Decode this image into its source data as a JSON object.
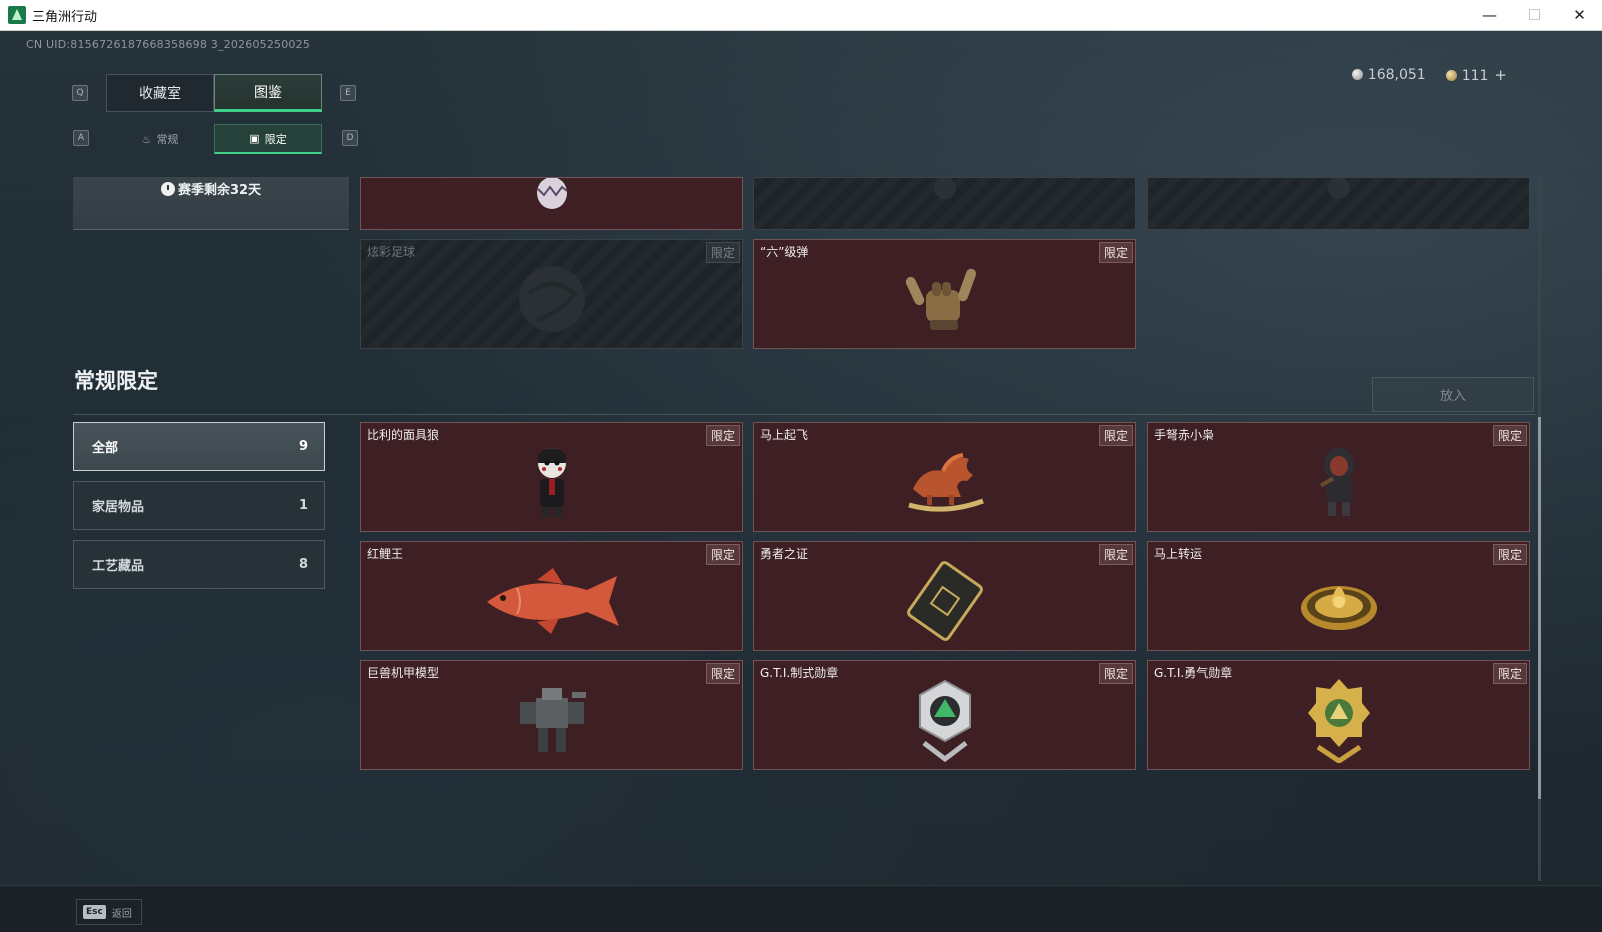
{
  "window": {
    "title": "三角洲行动",
    "min_glyph": "—",
    "max_glyph": "☐",
    "close_glyph": "✕"
  },
  "uid_text": "CN UID:8156726187668358698 3_202605250025",
  "currency": {
    "silver": "168,051",
    "gold": "111",
    "plus": "+"
  },
  "keys": {
    "prev_tab": "Q",
    "next_tab": "E",
    "prev_sub": "A",
    "next_sub": "D"
  },
  "tabs_main": [
    {
      "label": "收藏室",
      "active": false
    },
    {
      "label": "图鉴",
      "active": true
    }
  ],
  "tabs_sub": [
    {
      "label": "常规",
      "icon": "flame-icon",
      "active": false
    },
    {
      "label": "限定",
      "icon": "image-icon",
      "active": true
    }
  ],
  "season": {
    "text": "赛季剩余32天"
  },
  "top_cards": [
    {
      "name": "",
      "tag": "",
      "locked": false,
      "icon": "egg-icon"
    },
    {
      "name": "",
      "tag": "",
      "locked": true,
      "icon": "locked-item-icon"
    },
    {
      "name": "",
      "tag": "",
      "locked": true,
      "icon": "locked-item-icon"
    },
    {
      "name": "炫彩足球",
      "tag": "限定",
      "locked": true,
      "icon": "football-icon"
    },
    {
      "name": "“六”级弹",
      "tag": "限定",
      "locked": false,
      "icon": "hand-sign-icon"
    }
  ],
  "section": {
    "title": "常规限定",
    "put_button": "放入"
  },
  "filters": [
    {
      "label": "全部",
      "count": "9",
      "active": true
    },
    {
      "label": "家居物品",
      "count": "1",
      "active": false
    },
    {
      "label": "工艺藏品",
      "count": "8",
      "active": false
    }
  ],
  "items": [
    {
      "name": "比利的面具狼",
      "tag": "限定",
      "icon": "puppet-figure-icon"
    },
    {
      "name": "马上起飞",
      "tag": "限定",
      "icon": "rocking-horse-icon"
    },
    {
      "name": "手弩赤小枭",
      "tag": "限定",
      "icon": "hooded-figure-icon"
    },
    {
      "name": "红鲤王",
      "tag": "限定",
      "icon": "carp-fish-icon"
    },
    {
      "name": "勇者之证",
      "tag": "限定",
      "icon": "card-badge-icon"
    },
    {
      "name": "马上转运",
      "tag": "限定",
      "icon": "golden-wheel-icon"
    },
    {
      "name": "巨兽机甲模型",
      "tag": "限定",
      "icon": "mech-model-icon"
    },
    {
      "name": "G.T.I.制式勋章",
      "tag": "限定",
      "icon": "silver-medal-icon"
    },
    {
      "name": "G.T.I.勇气勋章",
      "tag": "限定",
      "icon": "gold-medal-icon"
    }
  ],
  "footer": {
    "esc_key": "Esc",
    "esc_label": "返回"
  },
  "colors": {
    "accent": "#3fd08a",
    "card_bg": "#3e1f23",
    "panel_bg": "#1f2a30"
  }
}
